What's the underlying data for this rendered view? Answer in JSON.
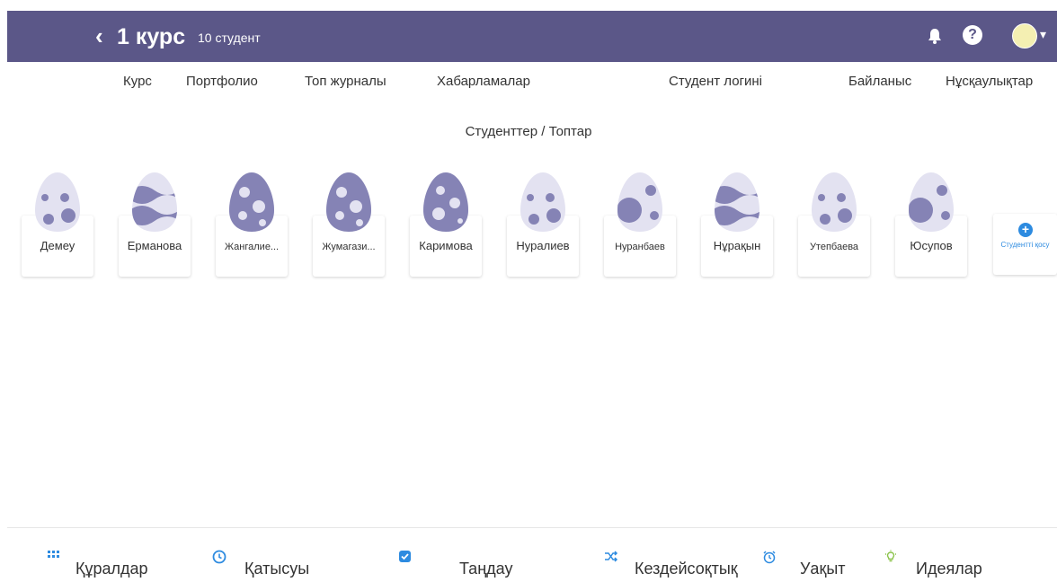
{
  "header": {
    "back_label": "‹",
    "title": "1 курс",
    "student_count": "10 студент",
    "help_label": "?",
    "avatar_caret": "▾"
  },
  "nav": {
    "items": [
      "Курс",
      "Портфолио",
      "Топ журналы",
      "Хабарламалар",
      "Студент логині",
      "Байланыс",
      "Нұсқаулықтар"
    ]
  },
  "breadcrumb": "Студенттер / Топтар",
  "students": [
    {
      "name": "Демеу",
      "pattern": "spots"
    },
    {
      "name": "Ерманова",
      "pattern": "waves"
    },
    {
      "name": "Жангалие...",
      "pattern": "stones"
    },
    {
      "name": "Жумагази...",
      "pattern": "stones"
    },
    {
      "name": "Каримова",
      "pattern": "dots"
    },
    {
      "name": "Нуралиев",
      "pattern": "spots"
    },
    {
      "name": "Нуранбаев",
      "pattern": "big"
    },
    {
      "name": "Нұрақын",
      "pattern": "waves"
    },
    {
      "name": "Утепбаева",
      "pattern": "spots"
    },
    {
      "name": "Юсупов",
      "pattern": "big"
    }
  ],
  "add_student": {
    "label": "Студентті қосу",
    "icon": "+"
  },
  "toolbar": {
    "items": [
      {
        "label": "Құралдар",
        "icon": "grid-icon"
      },
      {
        "label": "Қатысуы",
        "icon": "clock-icon"
      },
      {
        "label": "Таңдау",
        "icon": "checkbox-icon"
      },
      {
        "label": "Кездейсоқтық",
        "icon": "shuffle-icon"
      },
      {
        "label": "Уақыт",
        "icon": "alarm-icon"
      },
      {
        "label": "Идеялар",
        "icon": "lightbulb-icon"
      }
    ]
  },
  "colors": {
    "topbar": "#5b5788",
    "accent": "#2d8be0",
    "egg_light": "#e3e2f1",
    "egg_dark": "#8583b5"
  }
}
